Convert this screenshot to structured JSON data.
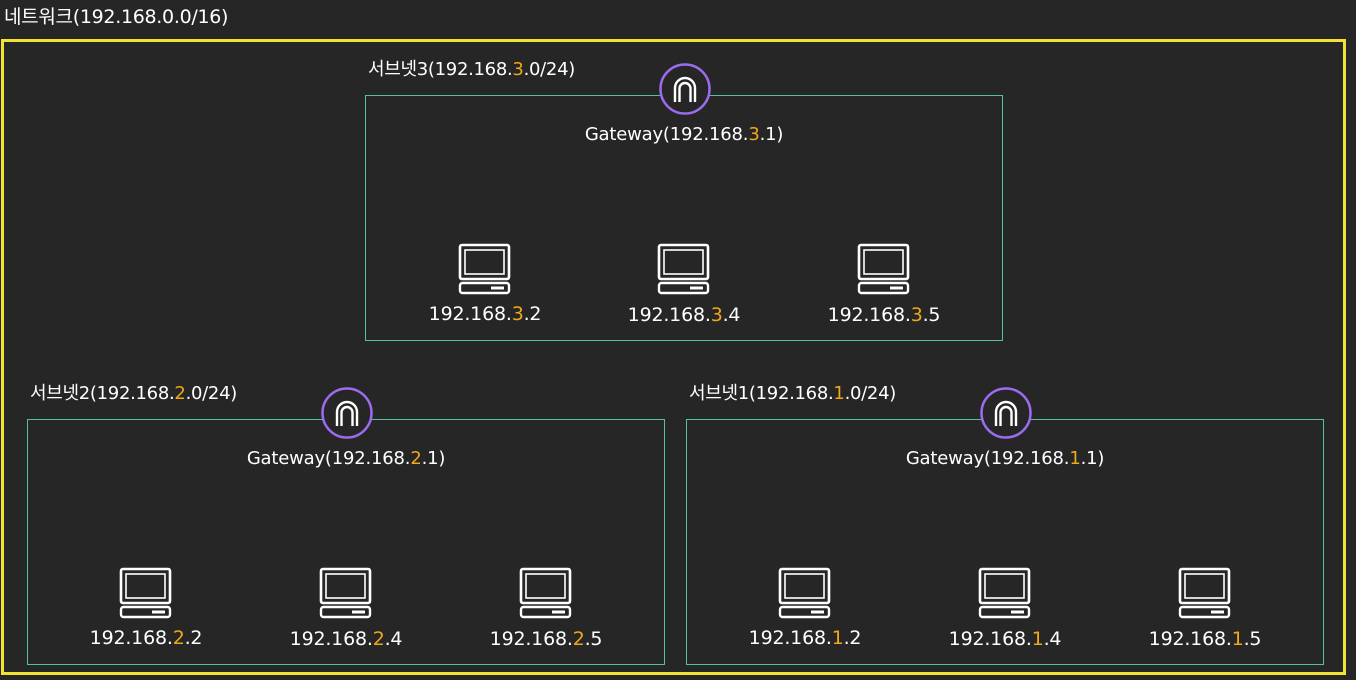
{
  "network": {
    "title": "네트워크(192.168.0.0/16)",
    "border_color": "#f2e233"
  },
  "colors": {
    "highlight": "#f0a818",
    "subnet_border": "#55bfa8",
    "gateway_icon": "#9b6cf0",
    "background": "#262626",
    "text": "#ffffff"
  },
  "subnets": [
    {
      "label_pre": "서브넷3(192.168.",
      "label_hl": "3",
      "label_post": ".0/24)",
      "gateway_icon": "gateway-arch-icon",
      "gateway_pre": "Gateway(192.168.",
      "gateway_hl": "3",
      "gateway_post": ".1)",
      "hosts": [
        {
          "icon": "computer-icon",
          "pre": "192.168.",
          "hl": "3",
          "post": ".2"
        },
        {
          "icon": "computer-icon",
          "pre": "192.168.",
          "hl": "3",
          "post": ".4"
        },
        {
          "icon": "computer-icon",
          "pre": "192.168.",
          "hl": "3",
          "post": ".5"
        }
      ]
    },
    {
      "label_pre": "서브넷2(192.168.",
      "label_hl": "2",
      "label_post": ".0/24)",
      "gateway_icon": "gateway-arch-icon",
      "gateway_pre": "Gateway(192.168.",
      "gateway_hl": "2",
      "gateway_post": ".1)",
      "hosts": [
        {
          "icon": "computer-icon",
          "pre": "192.168.",
          "hl": "2",
          "post": ".2"
        },
        {
          "icon": "computer-icon",
          "pre": "192.168.",
          "hl": "2",
          "post": ".4"
        },
        {
          "icon": "computer-icon",
          "pre": "192.168.",
          "hl": "2",
          "post": ".5"
        }
      ]
    },
    {
      "label_pre": "서브넷1(192.168.",
      "label_hl": "1",
      "label_post": ".0/24)",
      "gateway_icon": "gateway-arch-icon",
      "gateway_pre": "Gateway(192.168.",
      "gateway_hl": "1",
      "gateway_post": ".1)",
      "hosts": [
        {
          "icon": "computer-icon",
          "pre": "192.168.",
          "hl": "1",
          "post": ".2"
        },
        {
          "icon": "computer-icon",
          "pre": "192.168.",
          "hl": "1",
          "post": ".4"
        },
        {
          "icon": "computer-icon",
          "pre": "192.168.",
          "hl": "1",
          "post": ".5"
        }
      ]
    }
  ]
}
